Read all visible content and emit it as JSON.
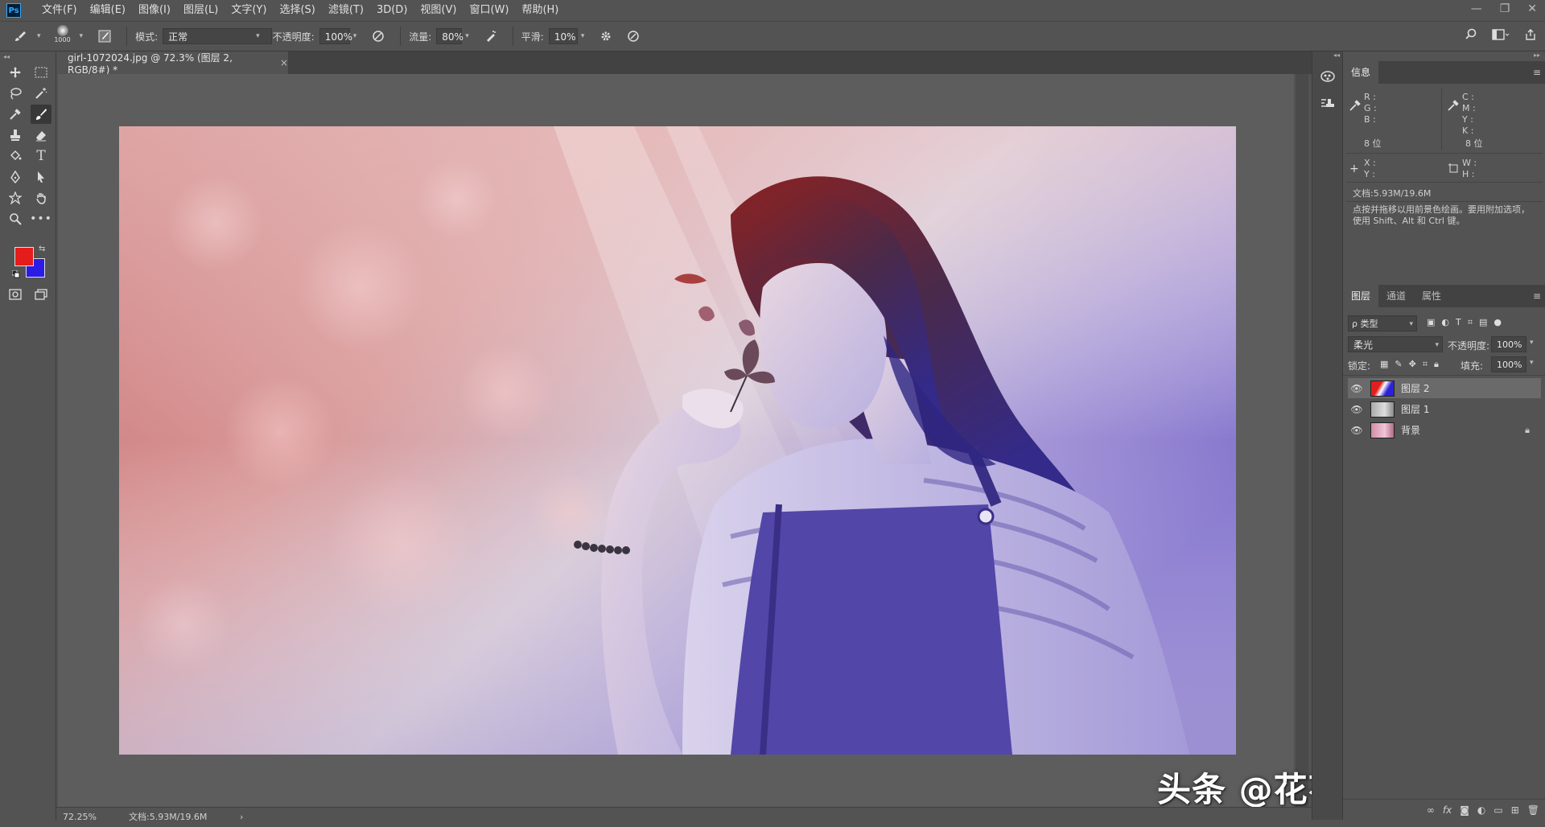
{
  "app": {
    "logo": "Ps"
  },
  "menu": [
    "文件(F)",
    "编辑(E)",
    "图像(I)",
    "图层(L)",
    "文字(Y)",
    "选择(S)",
    "滤镜(T)",
    "3D(D)",
    "视图(V)",
    "窗口(W)",
    "帮助(H)"
  ],
  "window_controls": [
    "—",
    "❐",
    "✕"
  ],
  "options": {
    "brush_size": "1000",
    "mode_label": "模式:",
    "mode_value": "正常",
    "opacity_label": "不透明度:",
    "opacity_value": "100%",
    "flow_label": "流量:",
    "flow_value": "80%",
    "smooth_label": "平滑:",
    "smooth_value": "10%"
  },
  "colors": {
    "foreground": "#e51c1c",
    "background": "#2a1ce6",
    "ui_bg": "#535353"
  },
  "document": {
    "tab_title": "girl-1072024.jpg @ 72.3% (图层 2, RGB/8#) *",
    "close": "×"
  },
  "status": {
    "zoom": "72.25%",
    "doc_size": "文档:5.93M/19.6M",
    "arrow": "›"
  },
  "info_panel": {
    "tab": "信息",
    "rgb_labels": [
      "R :",
      "G :",
      "B :"
    ],
    "cmyk_labels": [
      "C :",
      "M :",
      "Y :",
      "K :"
    ],
    "bits_left": "8 位",
    "bits_right": "8 位",
    "xy_labels": [
      "X :",
      "Y :"
    ],
    "wh_labels": [
      "W :",
      "H :"
    ],
    "doc_size": "文档:5.93M/19.6M",
    "hint": "点按并拖移以用前景色绘画。要用附加选项，使用 Shift、Alt 和 Ctrl 键。"
  },
  "layers_panel": {
    "tabs": [
      "图层",
      "通道",
      "属性"
    ],
    "filter": "ρ 类型",
    "blend_mode": "柔光",
    "opacity_label": "不透明度:",
    "opacity_value": "100%",
    "lock_label": "锁定:",
    "fill_label": "填充:",
    "fill_value": "100%",
    "layers": [
      {
        "name": "图层 2",
        "selected": true
      },
      {
        "name": "图层 1",
        "selected": false
      },
      {
        "name": "背景",
        "selected": false,
        "locked": true
      }
    ],
    "bottom_icons": [
      "link-icon",
      "fx-icon",
      "mask-icon",
      "adjustment-icon",
      "folder-icon",
      "new-layer-icon",
      "trash-icon"
    ]
  },
  "watermark": "头条 @花花平面设计"
}
